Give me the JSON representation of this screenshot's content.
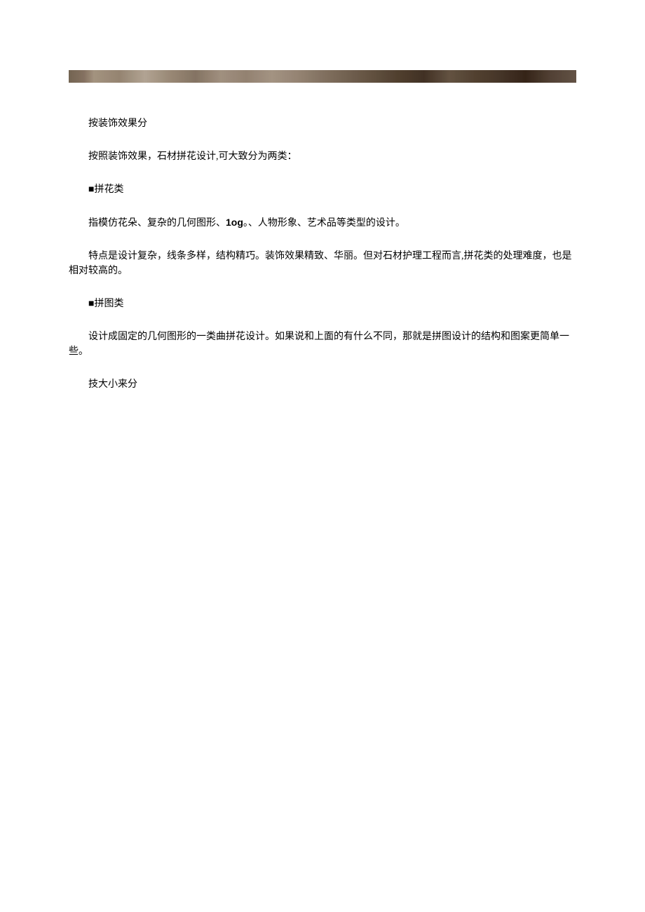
{
  "heading1": "按装饰效果分",
  "intro": "按照装饰效果，石材拼花设计,可大致分为两类：",
  "cat1_title": "■拼花类",
  "cat1_desc_a": "指模仿花朵、复杂的几何图形、",
  "cat1_desc_b": "1og",
  "cat1_desc_c": "。、人物形象、艺术品等类型的设计。",
  "cat1_feature": "特点是设计复杂，线条多样，结构精巧。装饰效果精致、华丽。但对石材护理工程而言,拼花类的处理难度，也是相对较高的。",
  "cat2_title": "■拼图类",
  "cat2_desc": "设计成固定的几何图形的一类曲拼花设计。如果说和上面的有什么不同，那就是拼图设计的结构和图案更简单一些。",
  "heading2": "技大小来分"
}
